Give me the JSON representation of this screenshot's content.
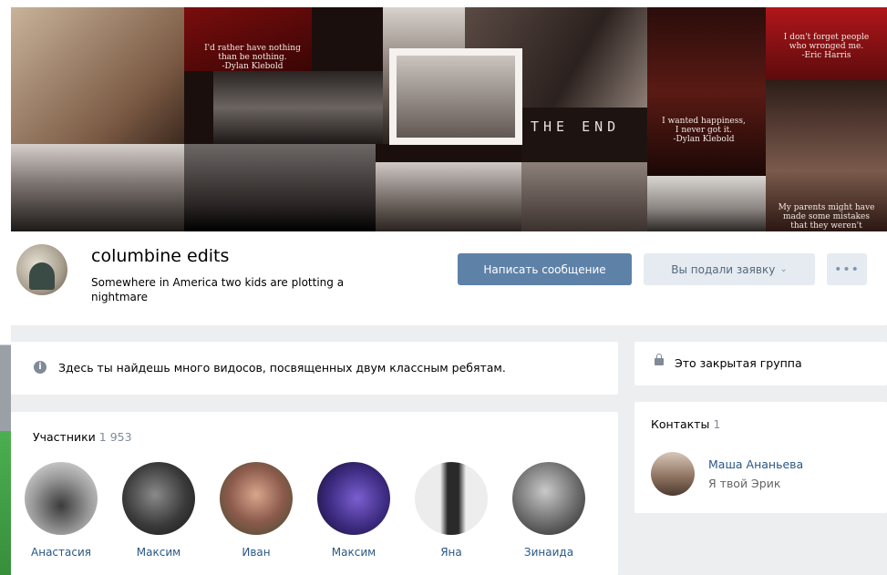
{
  "cover": {
    "quote1": "I'd rather have nothing\nthan be nothing.\n-Dylan Klebold",
    "quote2": "THE END",
    "quote3": "I wanted happiness,\nI never got it.\n-Dylan Klebold",
    "quote4": "I don't forget people\nwho wronged me.\n-Eric Harris",
    "quote5": "My parents might have\nmade some mistakes\nthat they weren't"
  },
  "group": {
    "name": "columbine edits",
    "status": "Somewhere in America two kids are plotting a nightmare"
  },
  "actions": {
    "message_label": "Написать сообщение",
    "request_label": "Вы подали заявку",
    "request_chevron": "⌄",
    "more_label": "•••"
  },
  "info": {
    "icon": "i",
    "text": "Здесь ты найдешь много видосов, посвященных двум классным ребятам."
  },
  "members": {
    "title": "Участники",
    "count": "1 953",
    "list": [
      {
        "name": "Анастасия"
      },
      {
        "name": "Максим"
      },
      {
        "name": "Иван"
      },
      {
        "name": "Максим"
      },
      {
        "name": "Яна"
      },
      {
        "name": "Зинаида"
      }
    ]
  },
  "closed": {
    "text": "Это закрытая группа"
  },
  "contacts": {
    "title": "Контакты",
    "count": "1",
    "name": "Маша Ананьева",
    "role": "Я твой Эрик"
  }
}
